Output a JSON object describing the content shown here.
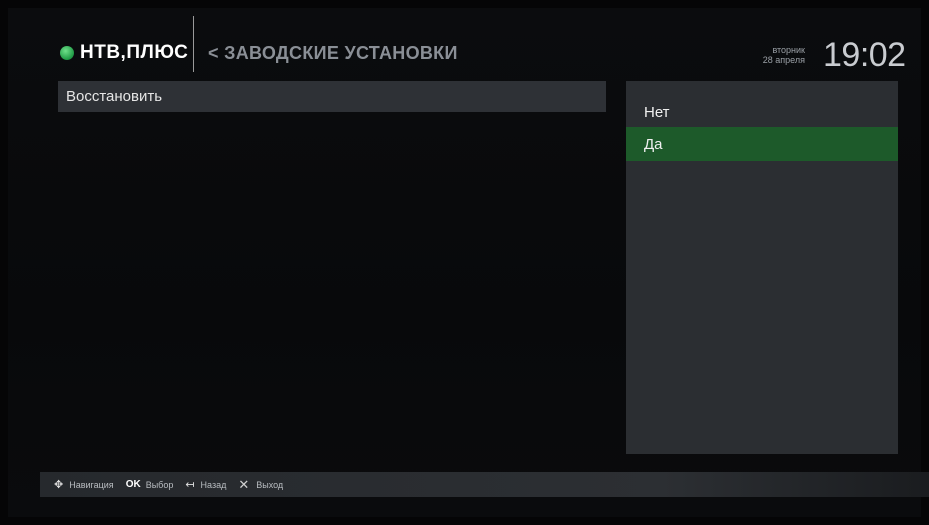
{
  "header": {
    "logo_text": "НТВ,ПЛЮС",
    "breadcrumb": "< ЗАВОДСКИЕ УСТАНОВКИ",
    "day_of_week": "вторник",
    "date": "28 апреля",
    "time": "19:02"
  },
  "settings": {
    "option_label": "Восстановить"
  },
  "choices": {
    "no": "Нет",
    "yes": "Да",
    "selected": "Да"
  },
  "footer": {
    "navigation": "Навигация",
    "ok_key": "OK",
    "ok_label": "Выбор",
    "back_label": "Назад",
    "exit_label": "Выход"
  },
  "colors": {
    "accent_green": "#1d5a2a",
    "panel": "#2b2e32",
    "background": "#08090b"
  },
  "icons": {
    "logo": "green-globe-icon",
    "navigation": "dpad-icon",
    "back": "back-arrow-icon",
    "exit": "close-icon"
  }
}
